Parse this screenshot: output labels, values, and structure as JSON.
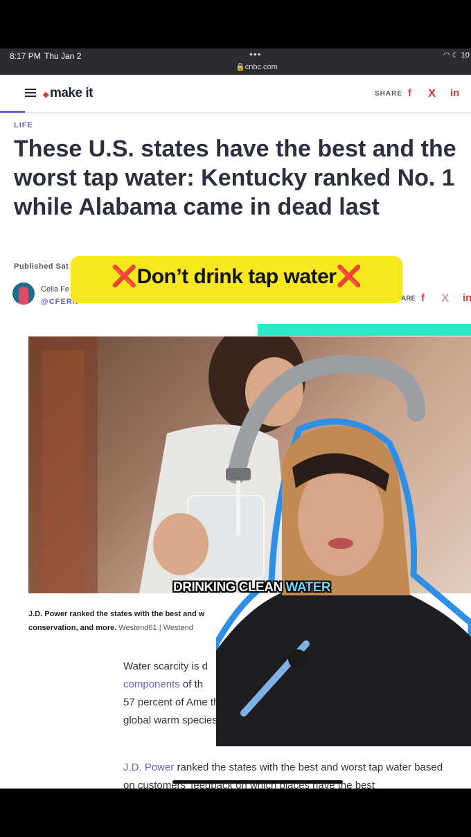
{
  "status_bar": {
    "time": "8:17 PM",
    "day": "Thu Jan 2",
    "url": "cnbc.com",
    "right": "10"
  },
  "nav": {
    "logo": "make it",
    "share_label": "SHARE",
    "social": {
      "facebook": "f",
      "x": "X",
      "linkedin": "in"
    }
  },
  "article": {
    "section": "LIFE",
    "headline": "These U.S. states have the best and the worst tap water: Kentucky ranked No. 1 while Alabama came in dead last",
    "published": "Published Sat",
    "author": "Celia Fe",
    "handle": "@CFERN",
    "share_label": "ARE",
    "caption": "J.D. Power ranked the states with the best and w conservation, and more.",
    "caption_credit": "Westend61 | Westend",
    "body1_prefix": "Water scarcity is d",
    "body1_link": "components",
    "body1_link_tail": " of th",
    "body1_rest": "57 percent of Ame than global warm species.",
    "body2_link": "J.D. Power",
    "body2_text": " ranked the states with the best and worst tap water based on customers' feedback on which places have the best"
  },
  "overlay": {
    "banner_x": "❌",
    "banner_text": "Don’t drink tap water",
    "subtitle_white": "DRINKING CLEAN",
    "subtitle_blue": "WATER"
  },
  "colors": {
    "accent": "#6c5fc7",
    "teal": "#2ce7c5",
    "banner": "#f7e71d",
    "social_red": "#d23b3b"
  }
}
